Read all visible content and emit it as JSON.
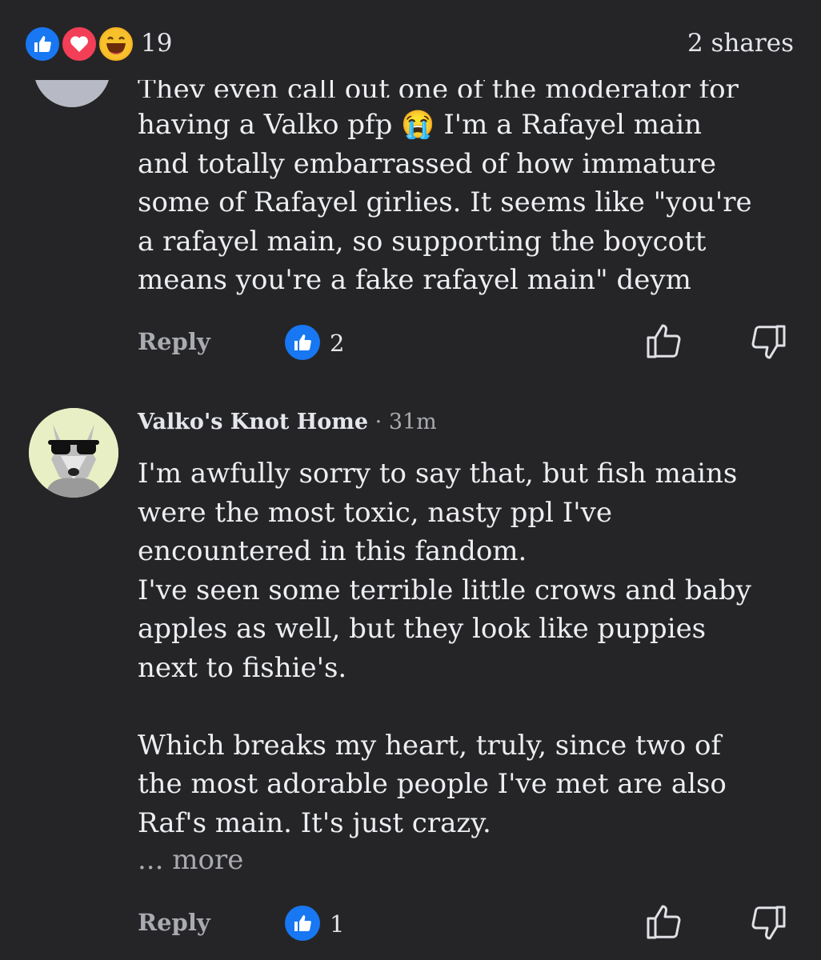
{
  "header": {
    "reaction_count": "19",
    "shares": "2 shares"
  },
  "comments": [
    {
      "partial_first_line": "They even call out one of the moderator for",
      "text_lines": [
        "having a Valko pfp 😭 I'm a Rafayel main",
        "and totally embarrassed of how immature",
        "some of Rafayel girlies. It seems like \"you're",
        "a rafayel main, so supporting the boycott",
        "means you're a fake rafayel main\" deym"
      ],
      "reply_label": "Reply",
      "like_count": "2"
    },
    {
      "author": "Valko's Knot Home",
      "time": "· 31m",
      "text_lines": [
        "I'm awfully sorry to say that, but fish mains",
        "were the most toxic, nasty ppl I've",
        "encountered in this fandom.",
        "I've seen some terrible little crows and baby",
        "apples as well, but they look like puppies",
        "next to fishie's.",
        "",
        "Which breaks my heart, truly, since two of",
        "the most adorable people I've met are also",
        "Raf's main. It's just crazy."
      ],
      "more_label": "... more",
      "reply_label": "Reply",
      "like_count": "1"
    }
  ],
  "icons": {
    "reactions": [
      "like-icon",
      "love-icon",
      "haha-icon"
    ],
    "actions": [
      "thumbs-up-icon",
      "thumbs-down-icon"
    ]
  },
  "colors": {
    "background": "#252527",
    "like_blue": "#1877f2",
    "love_red": "#f33e58",
    "haha_yellow": "#f7b125",
    "muted_text": "#a9abb0"
  }
}
